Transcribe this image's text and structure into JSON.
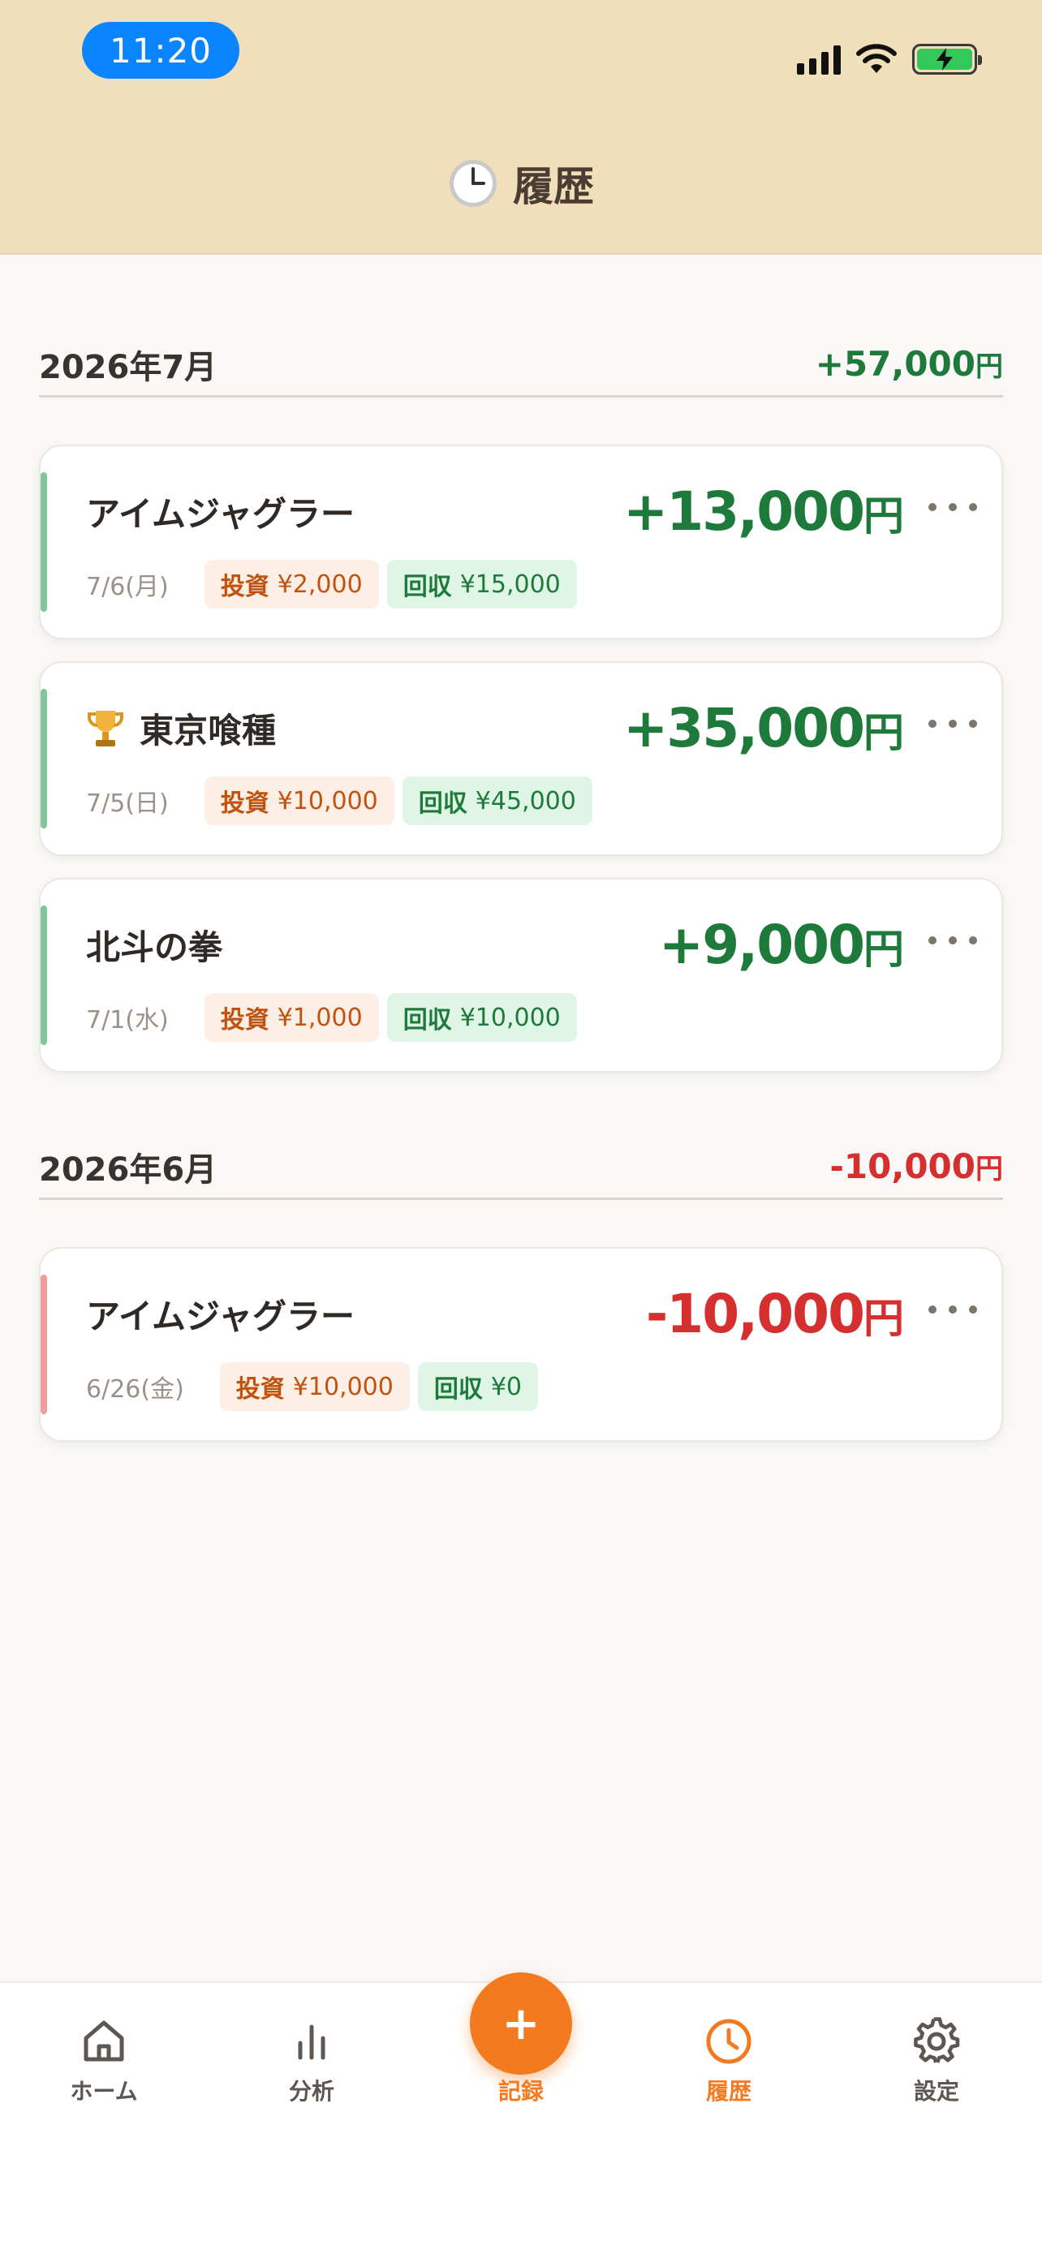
{
  "status_bar": {
    "time": "11:20"
  },
  "header": {
    "title": "履歴",
    "icon": "clock-emoji"
  },
  "months": [
    {
      "label": "2026年7月",
      "total": "+57,000",
      "total_unit": "円",
      "sign": "positive",
      "entries": [
        {
          "machine": "アイムジャグラー",
          "trophy": false,
          "amount": "+13,000",
          "amount_unit": "円",
          "date": "7/6(月)",
          "invest_label": "投資",
          "invest_value": "¥2,000",
          "recover_label": "回収",
          "recover_value": "¥15,000"
        },
        {
          "machine": "東京喰種",
          "trophy": true,
          "amount": "+35,000",
          "amount_unit": "円",
          "date": "7/5(日)",
          "invest_label": "投資",
          "invest_value": "¥10,000",
          "recover_label": "回収",
          "recover_value": "¥45,000"
        },
        {
          "machine": "北斗の拳",
          "trophy": false,
          "amount": "+9,000",
          "amount_unit": "円",
          "date": "7/1(水)",
          "invest_label": "投資",
          "invest_value": "¥1,000",
          "recover_label": "回収",
          "recover_value": "¥10,000"
        }
      ]
    },
    {
      "label": "2026年6月",
      "total": "-10,000",
      "total_unit": "円",
      "sign": "negative",
      "entries": [
        {
          "machine": "アイムジャグラー",
          "trophy": false,
          "amount": "-10,000",
          "amount_unit": "円",
          "date": "6/26(金)",
          "invest_label": "投資",
          "invest_value": "¥10,000",
          "recover_label": "回収",
          "recover_value": "¥0"
        }
      ]
    }
  ],
  "nav": {
    "home": "ホーム",
    "analysis": "分析",
    "record": "記録",
    "history": "履歴",
    "settings": "設定",
    "record_symbol": "+"
  },
  "colors": {
    "header_bg": "#f1deba",
    "positive": "#1e7a3a",
    "negative": "#d62f2f",
    "accent": "#f47a1f"
  }
}
